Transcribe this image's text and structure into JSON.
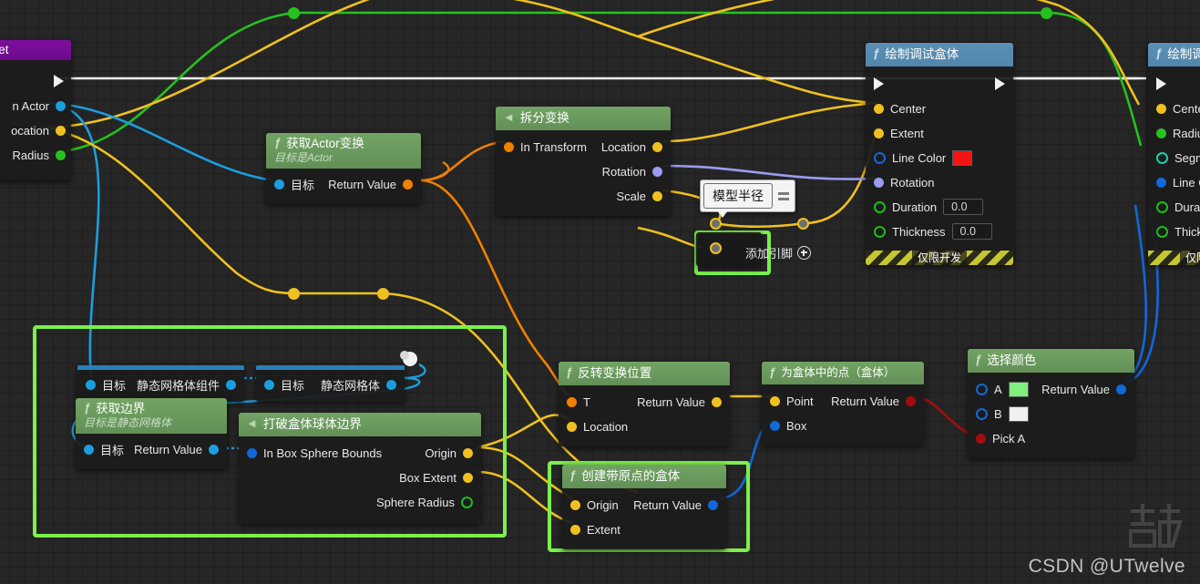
{
  "editor": {
    "name": "unreal-blueprint-graph",
    "watermark": "CSDN @UTwelve"
  },
  "tooltip": {
    "text": "模型半径"
  },
  "add_pin": {
    "label": "添加引脚"
  },
  "dev_only_label": "仅限开发",
  "nodes": {
    "target_node": {
      "title": "Target",
      "exec_label": "",
      "pins": [
        {
          "label": "n Actor",
          "color": "#1b9ede"
        },
        {
          "label": "ocation",
          "color": "#efc01f"
        },
        {
          "label": "Radius",
          "color": "#27c11f"
        }
      ]
    },
    "get_actor_transform": {
      "title": "获取Actor变换",
      "subtitle": "目标是Actor",
      "inputs": [
        {
          "label": "目标",
          "color": "#1b9ede"
        }
      ],
      "outputs": [
        {
          "label": "Return Value",
          "color": "#f08000"
        }
      ]
    },
    "break_transform": {
      "title": "拆分变换",
      "inputs": [
        {
          "label": "In Transform",
          "color": "#f08000"
        }
      ],
      "outputs": [
        {
          "label": "Location",
          "color": "#efc01f"
        },
        {
          "label": "Rotation",
          "color": "#9a9cf0"
        },
        {
          "label": "Scale",
          "color": "#efc01f"
        }
      ]
    },
    "draw_debug_box": {
      "title": "绘制调试盒体",
      "dev_only": "仅限开发",
      "rows": [
        {
          "label": "Center",
          "color": "#efc01f",
          "style": "solid"
        },
        {
          "label": "Extent",
          "color": "#efc01f",
          "style": "solid"
        },
        {
          "label": "Line Color",
          "color": "#1168d8",
          "style": "hollow",
          "swatch": "#f41414"
        },
        {
          "label": "Rotation",
          "color": "#9a9cf0",
          "style": "solid"
        },
        {
          "label": "Duration",
          "color": "#27c11f",
          "style": "hollow",
          "value": "0.0"
        },
        {
          "label": "Thickness",
          "color": "#27c11f",
          "style": "hollow",
          "value": "0.0"
        }
      ]
    },
    "draw_debug_sphere": {
      "title": "绘制调",
      "dev_only": "仅限开发",
      "rows": [
        {
          "label": "Cente",
          "color": "#efc01f",
          "style": "solid"
        },
        {
          "label": "Radius",
          "color": "#27c11f",
          "style": "solid"
        },
        {
          "label": "Segm",
          "color": "#1ad1a5",
          "style": "hollow"
        },
        {
          "label": "Line C",
          "color": "#1168d8",
          "style": "solid"
        },
        {
          "label": "Durati",
          "color": "#27c11f",
          "style": "hollow"
        },
        {
          "label": "Thickn",
          "color": "#27c11f",
          "style": "hollow"
        }
      ]
    },
    "get_static_mesh_component": {
      "inputs": [
        {
          "label": "目标",
          "color": "#1b9ede"
        }
      ],
      "outputs": [
        {
          "label": "静态网格体组件",
          "color": "#1b9ede"
        }
      ]
    },
    "get_static_mesh": {
      "inputs": [
        {
          "label": "目标",
          "color": "#1b9ede"
        }
      ],
      "outputs": [
        {
          "label": "静态网格体",
          "color": "#1b9ede"
        }
      ]
    },
    "get_bounds": {
      "title": "获取边界",
      "subtitle": "目标是静态网格体",
      "inputs": [
        {
          "label": "目标",
          "color": "#1b9ede"
        }
      ],
      "outputs": [
        {
          "label": "Return Value",
          "color": "#1b9ede"
        }
      ]
    },
    "break_box_sphere_bounds": {
      "title": "打破盒体球体边界",
      "inputs": [
        {
          "label": "In Box Sphere Bounds",
          "color": "#1168d8"
        }
      ],
      "outputs": [
        {
          "label": "Origin",
          "color": "#efc01f",
          "style": "solid"
        },
        {
          "label": "Box Extent",
          "color": "#efc01f",
          "style": "solid"
        },
        {
          "label": "Sphere Radius",
          "color": "#27c11f",
          "style": "hollow"
        }
      ]
    },
    "inverse_transform_location": {
      "title": "反转变换位置",
      "inputs": [
        {
          "label": "T",
          "color": "#f08000"
        },
        {
          "label": "Location",
          "color": "#efc01f"
        }
      ],
      "outputs": [
        {
          "label": "Return Value",
          "color": "#efc01f"
        }
      ]
    },
    "is_point_in_box": {
      "title": "为盒体中的点（盒体）",
      "inputs": [
        {
          "label": "Point",
          "color": "#efc01f"
        },
        {
          "label": "Box",
          "color": "#1168d8"
        }
      ],
      "outputs": [
        {
          "label": "Return Value",
          "color": "#a30d0d"
        }
      ]
    },
    "make_box_with_origin": {
      "title": "创建带原点的盒体",
      "inputs": [
        {
          "label": "Origin",
          "color": "#efc01f"
        },
        {
          "label": "Extent",
          "color": "#efc01f"
        }
      ],
      "outputs": [
        {
          "label": "Return Value",
          "color": "#1168d8"
        }
      ]
    },
    "select_color": {
      "title": "选择颜色",
      "inputs": [
        {
          "label": "A",
          "color": "#1168d8",
          "style": "hollow",
          "swatch": "#7ef07e"
        },
        {
          "label": "B",
          "color": "#1168d8",
          "style": "hollow",
          "swatch": "#f0f0f0"
        },
        {
          "label": "Pick A",
          "color": "#a30d0d",
          "style": "solid"
        }
      ],
      "outputs": [
        {
          "label": "Return Value",
          "color": "#1168d8"
        }
      ]
    }
  },
  "wire_colors": {
    "exec": "#f2f2f2",
    "object": "#1b9ede",
    "vector": "#efc01f",
    "transform": "#f08000",
    "float": "#27c11f",
    "rotator": "#9a9cf0",
    "boolean": "#a30d0d",
    "struct": "#1168d8",
    "selection": "#7bf04a"
  }
}
